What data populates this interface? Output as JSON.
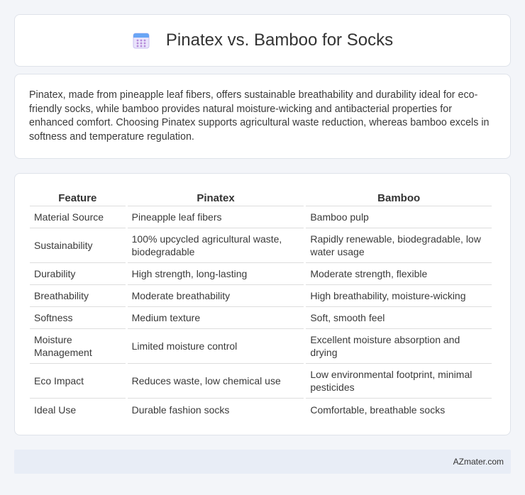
{
  "header": {
    "title": "Pinatex vs. Bamboo for Socks",
    "icon": "calendar-icon"
  },
  "summary": {
    "text": "Pinatex, made from pineapple leaf fibers, offers sustainable breathability and durability ideal for eco-friendly socks, while bamboo provides natural moisture-wicking and antibacterial properties for enhanced comfort. Choosing Pinatex supports agricultural waste reduction, whereas bamboo excels in softness and temperature regulation."
  },
  "table": {
    "headers": [
      "Feature",
      "Pinatex",
      "Bamboo"
    ],
    "rows": [
      [
        "Material Source",
        "Pineapple leaf fibers",
        "Bamboo pulp"
      ],
      [
        "Sustainability",
        "100% upcycled agricultural waste, biodegradable",
        "Rapidly renewable, biodegradable, low water usage"
      ],
      [
        "Durability",
        "High strength, long-lasting",
        "Moderate strength, flexible"
      ],
      [
        "Breathability",
        "Moderate breathability",
        "High breathability, moisture-wicking"
      ],
      [
        "Softness",
        "Medium texture",
        "Soft, smooth feel"
      ],
      [
        "Moisture Management",
        "Limited moisture control",
        "Excellent moisture absorption and drying"
      ],
      [
        "Eco Impact",
        "Reduces waste, low chemical use",
        "Low environmental footprint, minimal pesticides"
      ],
      [
        "Ideal Use",
        "Durable fashion socks",
        "Comfortable, breathable socks"
      ]
    ]
  },
  "footer": {
    "brand": "AZmater.com"
  }
}
